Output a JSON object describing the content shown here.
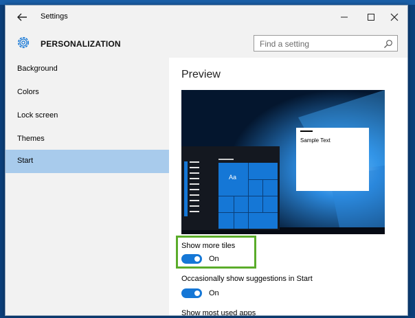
{
  "window": {
    "title": "Settings",
    "section": "PERSONALIZATION"
  },
  "search": {
    "placeholder": "Find a setting"
  },
  "sidebar": {
    "items": [
      {
        "label": "Background"
      },
      {
        "label": "Colors"
      },
      {
        "label": "Lock screen"
      },
      {
        "label": "Themes"
      },
      {
        "label": "Start",
        "active": true
      }
    ]
  },
  "main": {
    "preview_title": "Preview",
    "preview_sample_text": "Sample Text",
    "preview_tile_label": "Aa",
    "settings": [
      {
        "label": "Show more tiles",
        "state": "On",
        "on": true
      },
      {
        "label": "Occasionally show suggestions in Start",
        "state": "On",
        "on": true
      },
      {
        "label": "Show most used apps"
      }
    ]
  },
  "colors": {
    "accent": "#1577d6",
    "active_nav": "#a8cbec",
    "highlight": "#5aac2a"
  },
  "icons": {
    "back": "back-arrow-icon",
    "settings": "gear-icon",
    "search": "search-icon",
    "minimize": "minimize-icon",
    "maximize": "maximize-icon",
    "close": "close-icon"
  }
}
